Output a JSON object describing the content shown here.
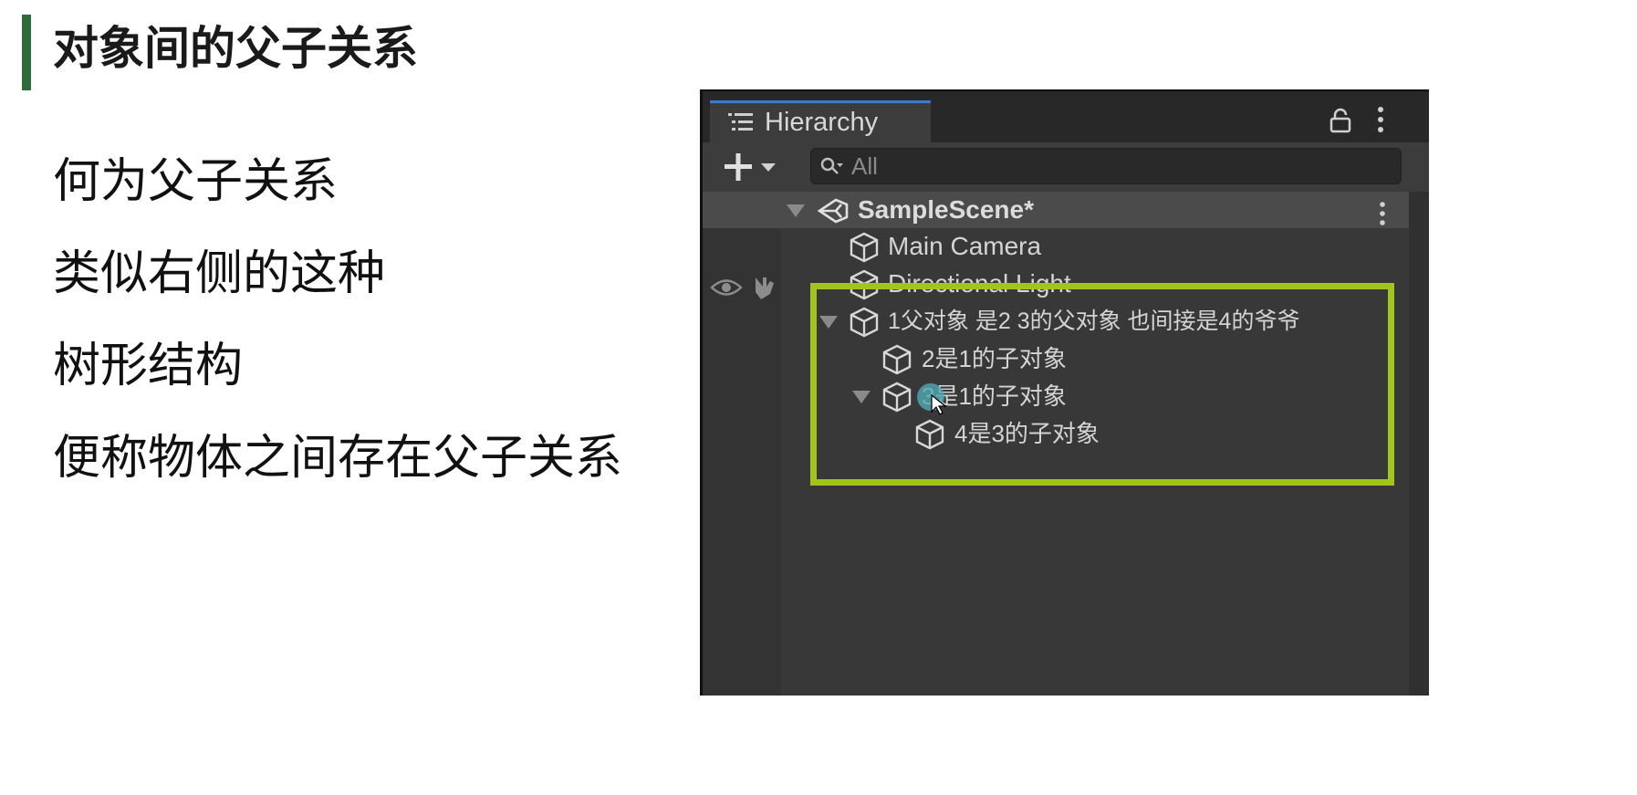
{
  "slide": {
    "title": "对象间的父子关系",
    "accent_color": "#2f6b3a",
    "bullets": [
      "何为父子关系",
      "类似右侧的这种",
      "树形结构",
      "便称物体之间存在父子关系"
    ]
  },
  "hierarchy_panel": {
    "tab_label": "Hierarchy",
    "search_placeholder": "All",
    "scene": {
      "name": "SampleScene*",
      "expanded": true
    },
    "items": [
      {
        "label": "Main Camera",
        "depth": 1,
        "expandable": false
      },
      {
        "label": "Directional Light",
        "depth": 1,
        "expandable": false
      },
      {
        "label": "1父对象 是2 3的父对象 也间接是4的爷爷",
        "depth": 1,
        "expandable": true,
        "expanded": true
      },
      {
        "label": "2是1的子对象",
        "depth": 2,
        "expandable": false
      },
      {
        "label": "3是1的子对象",
        "depth": 2,
        "expandable": true,
        "expanded": true
      },
      {
        "label": "4是3的子对象",
        "depth": 3,
        "expandable": false
      }
    ],
    "highlight_color": "#a2c41e",
    "tab_accent_color": "#3a79d4"
  },
  "icons": {
    "list": "hierarchy-list-icon",
    "lock": "lock-icon",
    "menu": "kebab-menu-icon",
    "add": "plus-dropdown-icon",
    "search": "search-icon",
    "scene": "unity-scene-icon",
    "gameobject": "cube-icon",
    "visibility": "eye-icon",
    "pickable": "hand-icon"
  }
}
